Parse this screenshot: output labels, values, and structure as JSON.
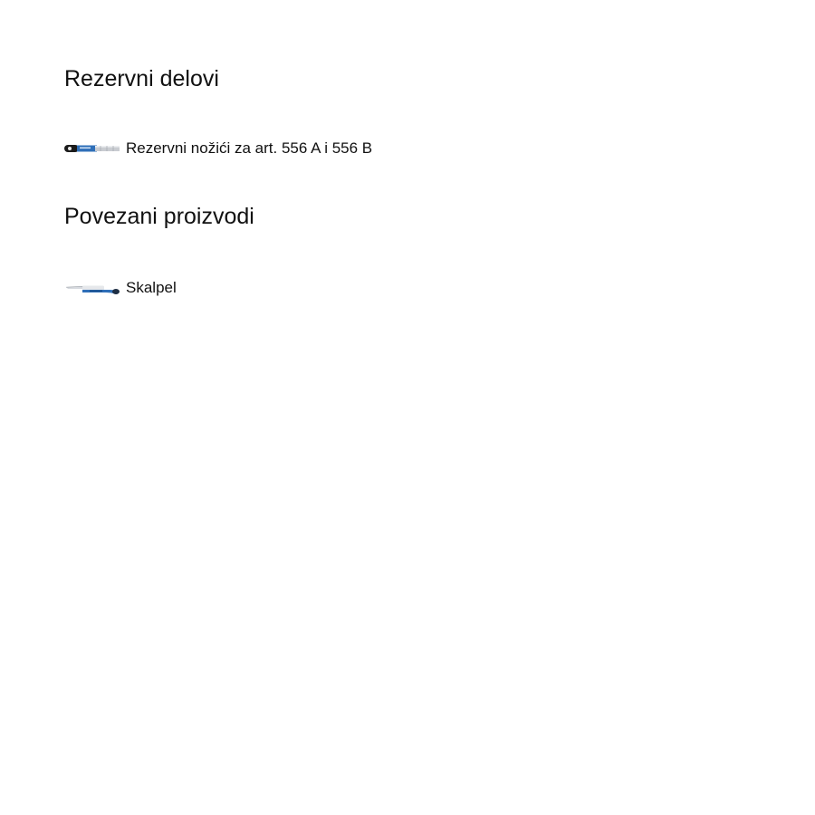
{
  "sections": [
    {
      "heading": "Rezervni delovi",
      "items": [
        {
          "label": "Rezervni nožići za art. 556 A i 556 B",
          "icon": "spare-blades-pack-icon"
        }
      ]
    },
    {
      "heading": "Povezani proizvodi",
      "items": [
        {
          "label": "Skalpel",
          "icon": "utility-knife-icon"
        }
      ]
    }
  ],
  "colors": {
    "text": "#111111",
    "background": "#ffffff",
    "brand_blue": "#2f6fb8"
  }
}
